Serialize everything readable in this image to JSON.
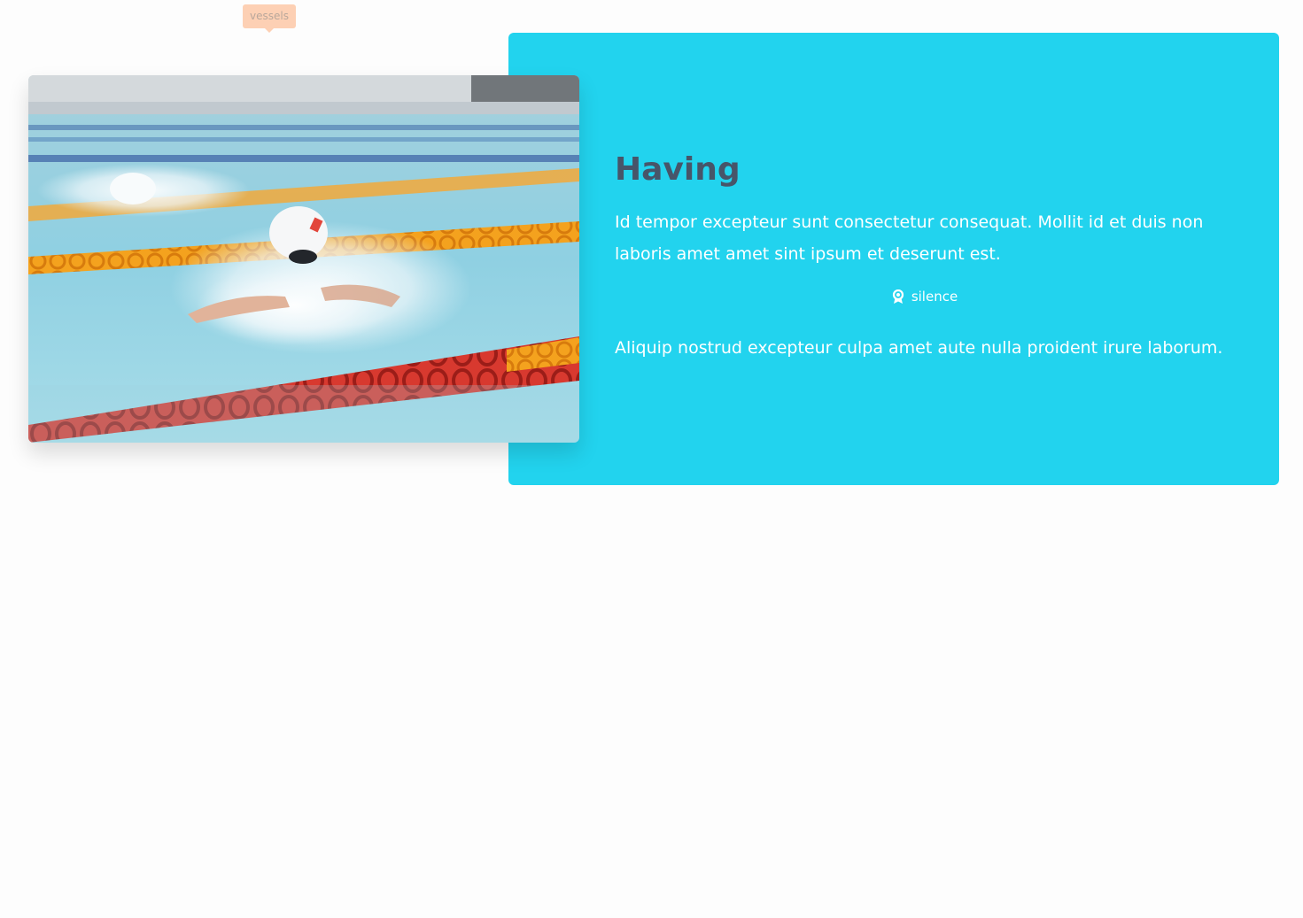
{
  "tag": {
    "label": "vessels"
  },
  "card": {
    "title": "Having",
    "description": "Id tempor excepteur sunt consectetur consequat. Mollit id et duis non laboris amet amet sint ipsum et deserunt est.",
    "badge": {
      "icon": "award-icon",
      "label": "silence"
    },
    "note": "Aliquip nostrud excepteur culpa amet aute nulla proident irure laborum."
  },
  "photo": {
    "subject": "swimmer-in-pool"
  },
  "colors": {
    "card_bg": "#22d3ee",
    "heading": "#475569",
    "tag_bg": "#fdd0b4"
  }
}
